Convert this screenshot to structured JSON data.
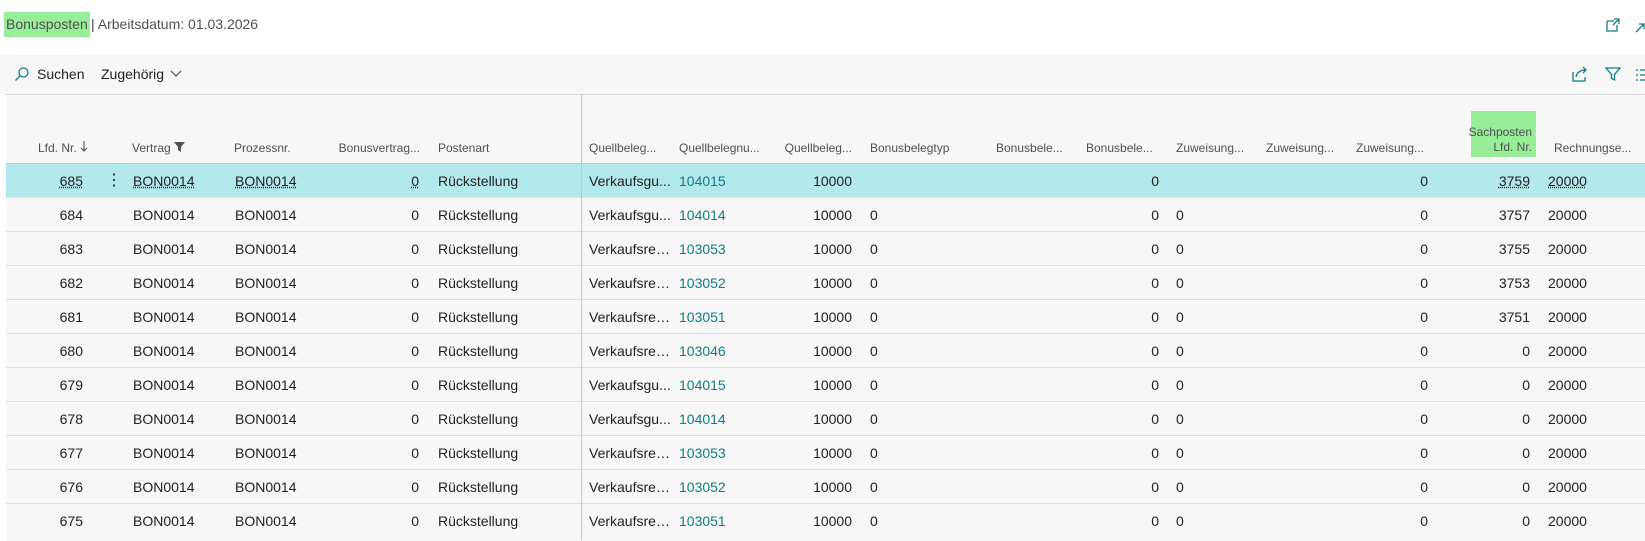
{
  "title": {
    "page": "Bonusposten",
    "separator": "|",
    "workdate": "Arbeitsdatum: 01.03.2026"
  },
  "icons": {
    "open_new_window": "open-new-window-icon",
    "expand": "expand-icon",
    "share": "share-icon",
    "filter": "filter-icon",
    "list": "list-icon",
    "search": "search-icon",
    "chevron": "chevron-down-icon"
  },
  "toolbar": {
    "search_label": "Suchen",
    "related_label": "Zugehörig"
  },
  "columns": [
    {
      "label": "Lfd. Nr."
    },
    {
      "label": "Vertrag"
    },
    {
      "label": "Prozessnr."
    },
    {
      "label": "Bonusvertrag..."
    },
    {
      "label": "Postenart"
    },
    {
      "label": "Quellbeleg..."
    },
    {
      "label": "Quellbelegnu..."
    },
    {
      "label": "Quellbeleg..."
    },
    {
      "label": "Bonusbelegtyp"
    },
    {
      "label": "Bonusbele..."
    },
    {
      "label": "Bonusbele..."
    },
    {
      "label": "Zuweisung..."
    },
    {
      "label": "Zuweisung..."
    },
    {
      "label": "Zuweisung..."
    },
    {
      "label": "Sachposten",
      "label2": "Lfd. Nr."
    },
    {
      "label": "Rechnungse..."
    }
  ],
  "rows": [
    {
      "c": [
        "685",
        "BON0014",
        "BON0014",
        "0",
        "Rückstellung",
        "Verkaufsgu...",
        "104015",
        "10000",
        "",
        "",
        "0",
        "",
        "",
        "0",
        "3759",
        "20000"
      ]
    },
    {
      "c": [
        "684",
        "BON0014",
        "BON0014",
        "0",
        "Rückstellung",
        "Verkaufsgu...",
        "104014",
        "10000",
        "0",
        "",
        "0",
        "0",
        "",
        "0",
        "3757",
        "20000"
      ]
    },
    {
      "c": [
        "683",
        "BON0014",
        "BON0014",
        "0",
        "Rückstellung",
        "Verkaufsrec...",
        "103053",
        "10000",
        "0",
        "",
        "0",
        "0",
        "",
        "0",
        "3755",
        "20000"
      ]
    },
    {
      "c": [
        "682",
        "BON0014",
        "BON0014",
        "0",
        "Rückstellung",
        "Verkaufsrec...",
        "103052",
        "10000",
        "0",
        "",
        "0",
        "0",
        "",
        "0",
        "3753",
        "20000"
      ]
    },
    {
      "c": [
        "681",
        "BON0014",
        "BON0014",
        "0",
        "Rückstellung",
        "Verkaufsrec...",
        "103051",
        "10000",
        "0",
        "",
        "0",
        "0",
        "",
        "0",
        "3751",
        "20000"
      ]
    },
    {
      "c": [
        "680",
        "BON0014",
        "BON0014",
        "0",
        "Rückstellung",
        "Verkaufsrec...",
        "103046",
        "10000",
        "0",
        "",
        "0",
        "0",
        "",
        "0",
        "0",
        "20000"
      ]
    },
    {
      "c": [
        "679",
        "BON0014",
        "BON0014",
        "0",
        "Rückstellung",
        "Verkaufsgu...",
        "104015",
        "10000",
        "0",
        "",
        "0",
        "0",
        "",
        "0",
        "0",
        "20000"
      ]
    },
    {
      "c": [
        "678",
        "BON0014",
        "BON0014",
        "0",
        "Rückstellung",
        "Verkaufsgu...",
        "104014",
        "10000",
        "0",
        "",
        "0",
        "0",
        "",
        "0",
        "0",
        "20000"
      ]
    },
    {
      "c": [
        "677",
        "BON0014",
        "BON0014",
        "0",
        "Rückstellung",
        "Verkaufsrec...",
        "103053",
        "10000",
        "0",
        "",
        "0",
        "0",
        "",
        "0",
        "0",
        "20000"
      ]
    },
    {
      "c": [
        "676",
        "BON0014",
        "BON0014",
        "0",
        "Rückstellung",
        "Verkaufsrec...",
        "103052",
        "10000",
        "0",
        "",
        "0",
        "0",
        "",
        "0",
        "0",
        "20000"
      ]
    },
    {
      "c": [
        "675",
        "BON0014",
        "BON0014",
        "0",
        "Rückstellung",
        "Verkaufsrec...",
        "103051",
        "10000",
        "0",
        "",
        "0",
        "0",
        "",
        "0",
        "0",
        "20000"
      ]
    }
  ],
  "colors": {
    "title_highlight": "#98ee98",
    "selected_row": "#b3e8ec",
    "link": "#0e7c86"
  }
}
